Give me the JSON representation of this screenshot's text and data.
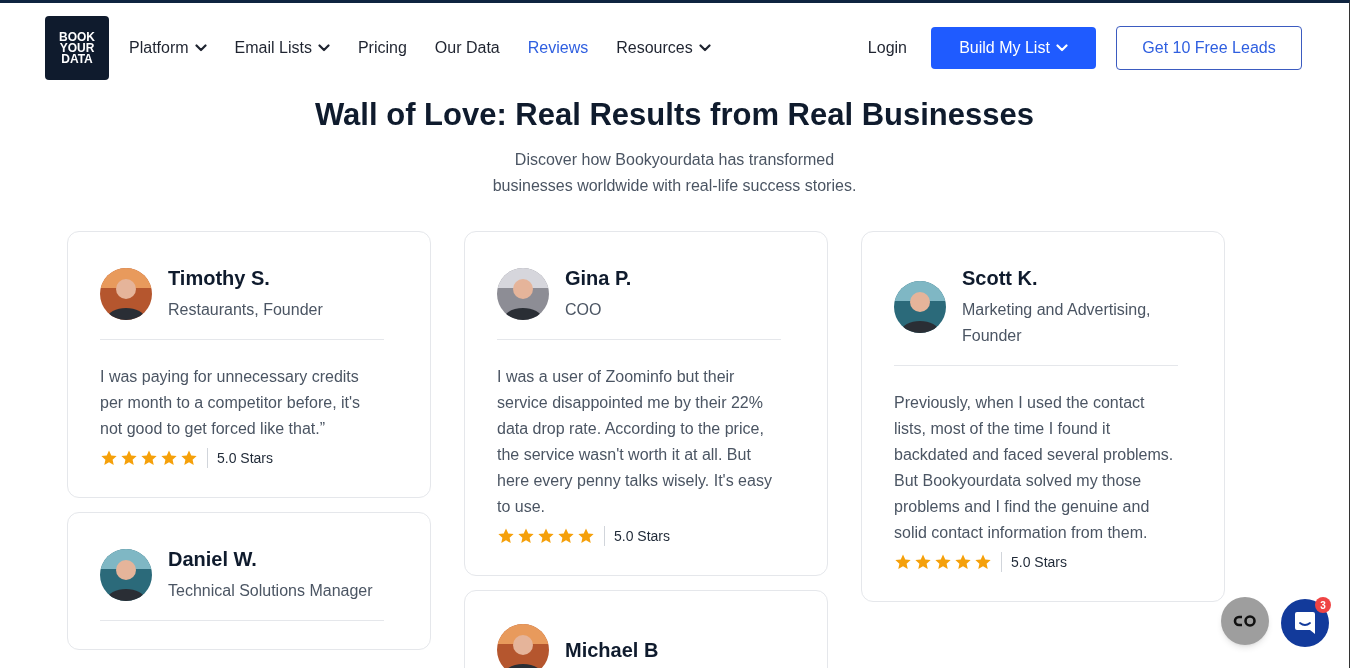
{
  "logo": "BOOK YOUR DATA",
  "nav": [
    {
      "label": "Platform",
      "dropdown": true,
      "selected": false
    },
    {
      "label": "Email Lists",
      "dropdown": true,
      "selected": false
    },
    {
      "label": "Pricing",
      "dropdown": false,
      "selected": false
    },
    {
      "label": "Our Data",
      "dropdown": false,
      "selected": false
    },
    {
      "label": "Reviews",
      "dropdown": false,
      "selected": true
    },
    {
      "label": "Resources",
      "dropdown": true,
      "selected": false
    }
  ],
  "login": "Login",
  "primary_button": {
    "label": "Build My List",
    "dropdown": true
  },
  "secondary_button": "Get 10 Free Leads",
  "heading": "Wall of Love: Real Results from Real Businesses",
  "subtitle": [
    "Discover how Bookyourdata has transformed",
    "businesses worldwide with real-life success stories."
  ],
  "columns": [
    [
      {
        "name": "Timothy S.",
        "role": "Restaurants, Founder",
        "quote": "I was paying for unnecessary credits per month to a competitor before, it's not good to get forced like that.”",
        "stars": 5,
        "rating": "5.0 Stars"
      },
      {
        "name": "Daniel W.",
        "role": "Technical Solutions Manager"
      }
    ],
    [
      {
        "name": "Gina P.",
        "role": "COO",
        "quote": "I was a user of Zoominfo but their service disappointed me by their 22% data drop rate. According to the price, the service wasn't worth it at all. But here every penny talks wisely. It's easy to use.",
        "stars": 5,
        "rating": "5.0 Stars"
      },
      {
        "name": "Michael B"
      }
    ],
    [
      {
        "name": "Scott K.",
        "role": "Marketing and Advertising, Founder",
        "quote": "Previously, when I used the contact lists, most of the time I found it backdated and faced several problems. But Bookyourdata solved my those problems and I find the genuine and solid contact information from them.",
        "stars": 5,
        "rating": "5.0 Stars"
      }
    ]
  ],
  "chat_badge": "3"
}
